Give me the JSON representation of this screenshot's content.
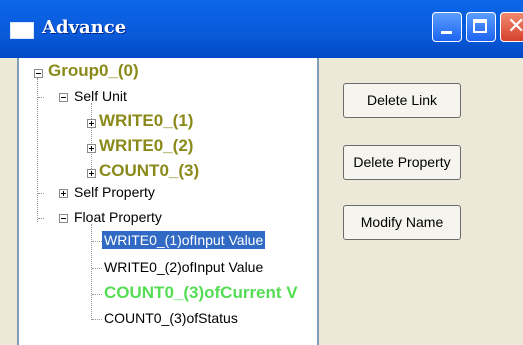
{
  "window": {
    "title": "Advance",
    "controls": [
      "minimize-icon",
      "maximize-icon",
      "close-icon"
    ]
  },
  "tree": {
    "root": "Group0_(0)",
    "self_unit": {
      "label": "Self Unit",
      "children": [
        "WRITE0_(1)",
        "WRITE0_(2)",
        "COUNT0_(3)"
      ]
    },
    "self_property": {
      "label": "Self Property"
    },
    "float_property": {
      "label": "Float Property",
      "children": [
        "WRITE0_(1)ofInput Value",
        "WRITE0_(2)ofInput Value",
        "COUNT0_(3)ofCurrent V",
        "COUNT0_(3)ofStatus"
      ],
      "selected_index": 0
    }
  },
  "buttons": {
    "delete_link": "Delete Link",
    "delete_property": "Delete Property",
    "modify_name": "Modify Name"
  },
  "colors": {
    "titlebar": "#0A5ADA",
    "selection": "#316AC5",
    "unit_text": "#8A8A1A",
    "highlight_green": "#55DD55"
  }
}
